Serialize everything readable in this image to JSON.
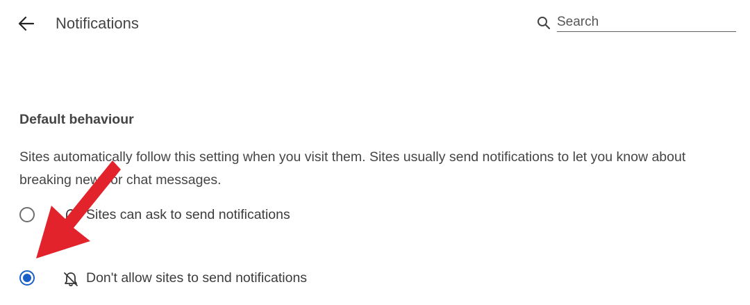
{
  "header": {
    "title": "Notifications",
    "search_placeholder": "Search"
  },
  "section": {
    "heading": "Default behaviour",
    "description": "Sites automatically follow this setting when you visit them. Sites usually send notifications to let you know about breaking news or chat messages."
  },
  "options": [
    {
      "label": "Sites can ask to send notifications",
      "icon": "bell-icon",
      "selected": false
    },
    {
      "label": "Don't allow sites to send notifications",
      "icon": "bell-off-icon",
      "selected": true
    }
  ],
  "colors": {
    "accent": "#1a5fc8",
    "annotation_arrow": "#e3232b"
  }
}
